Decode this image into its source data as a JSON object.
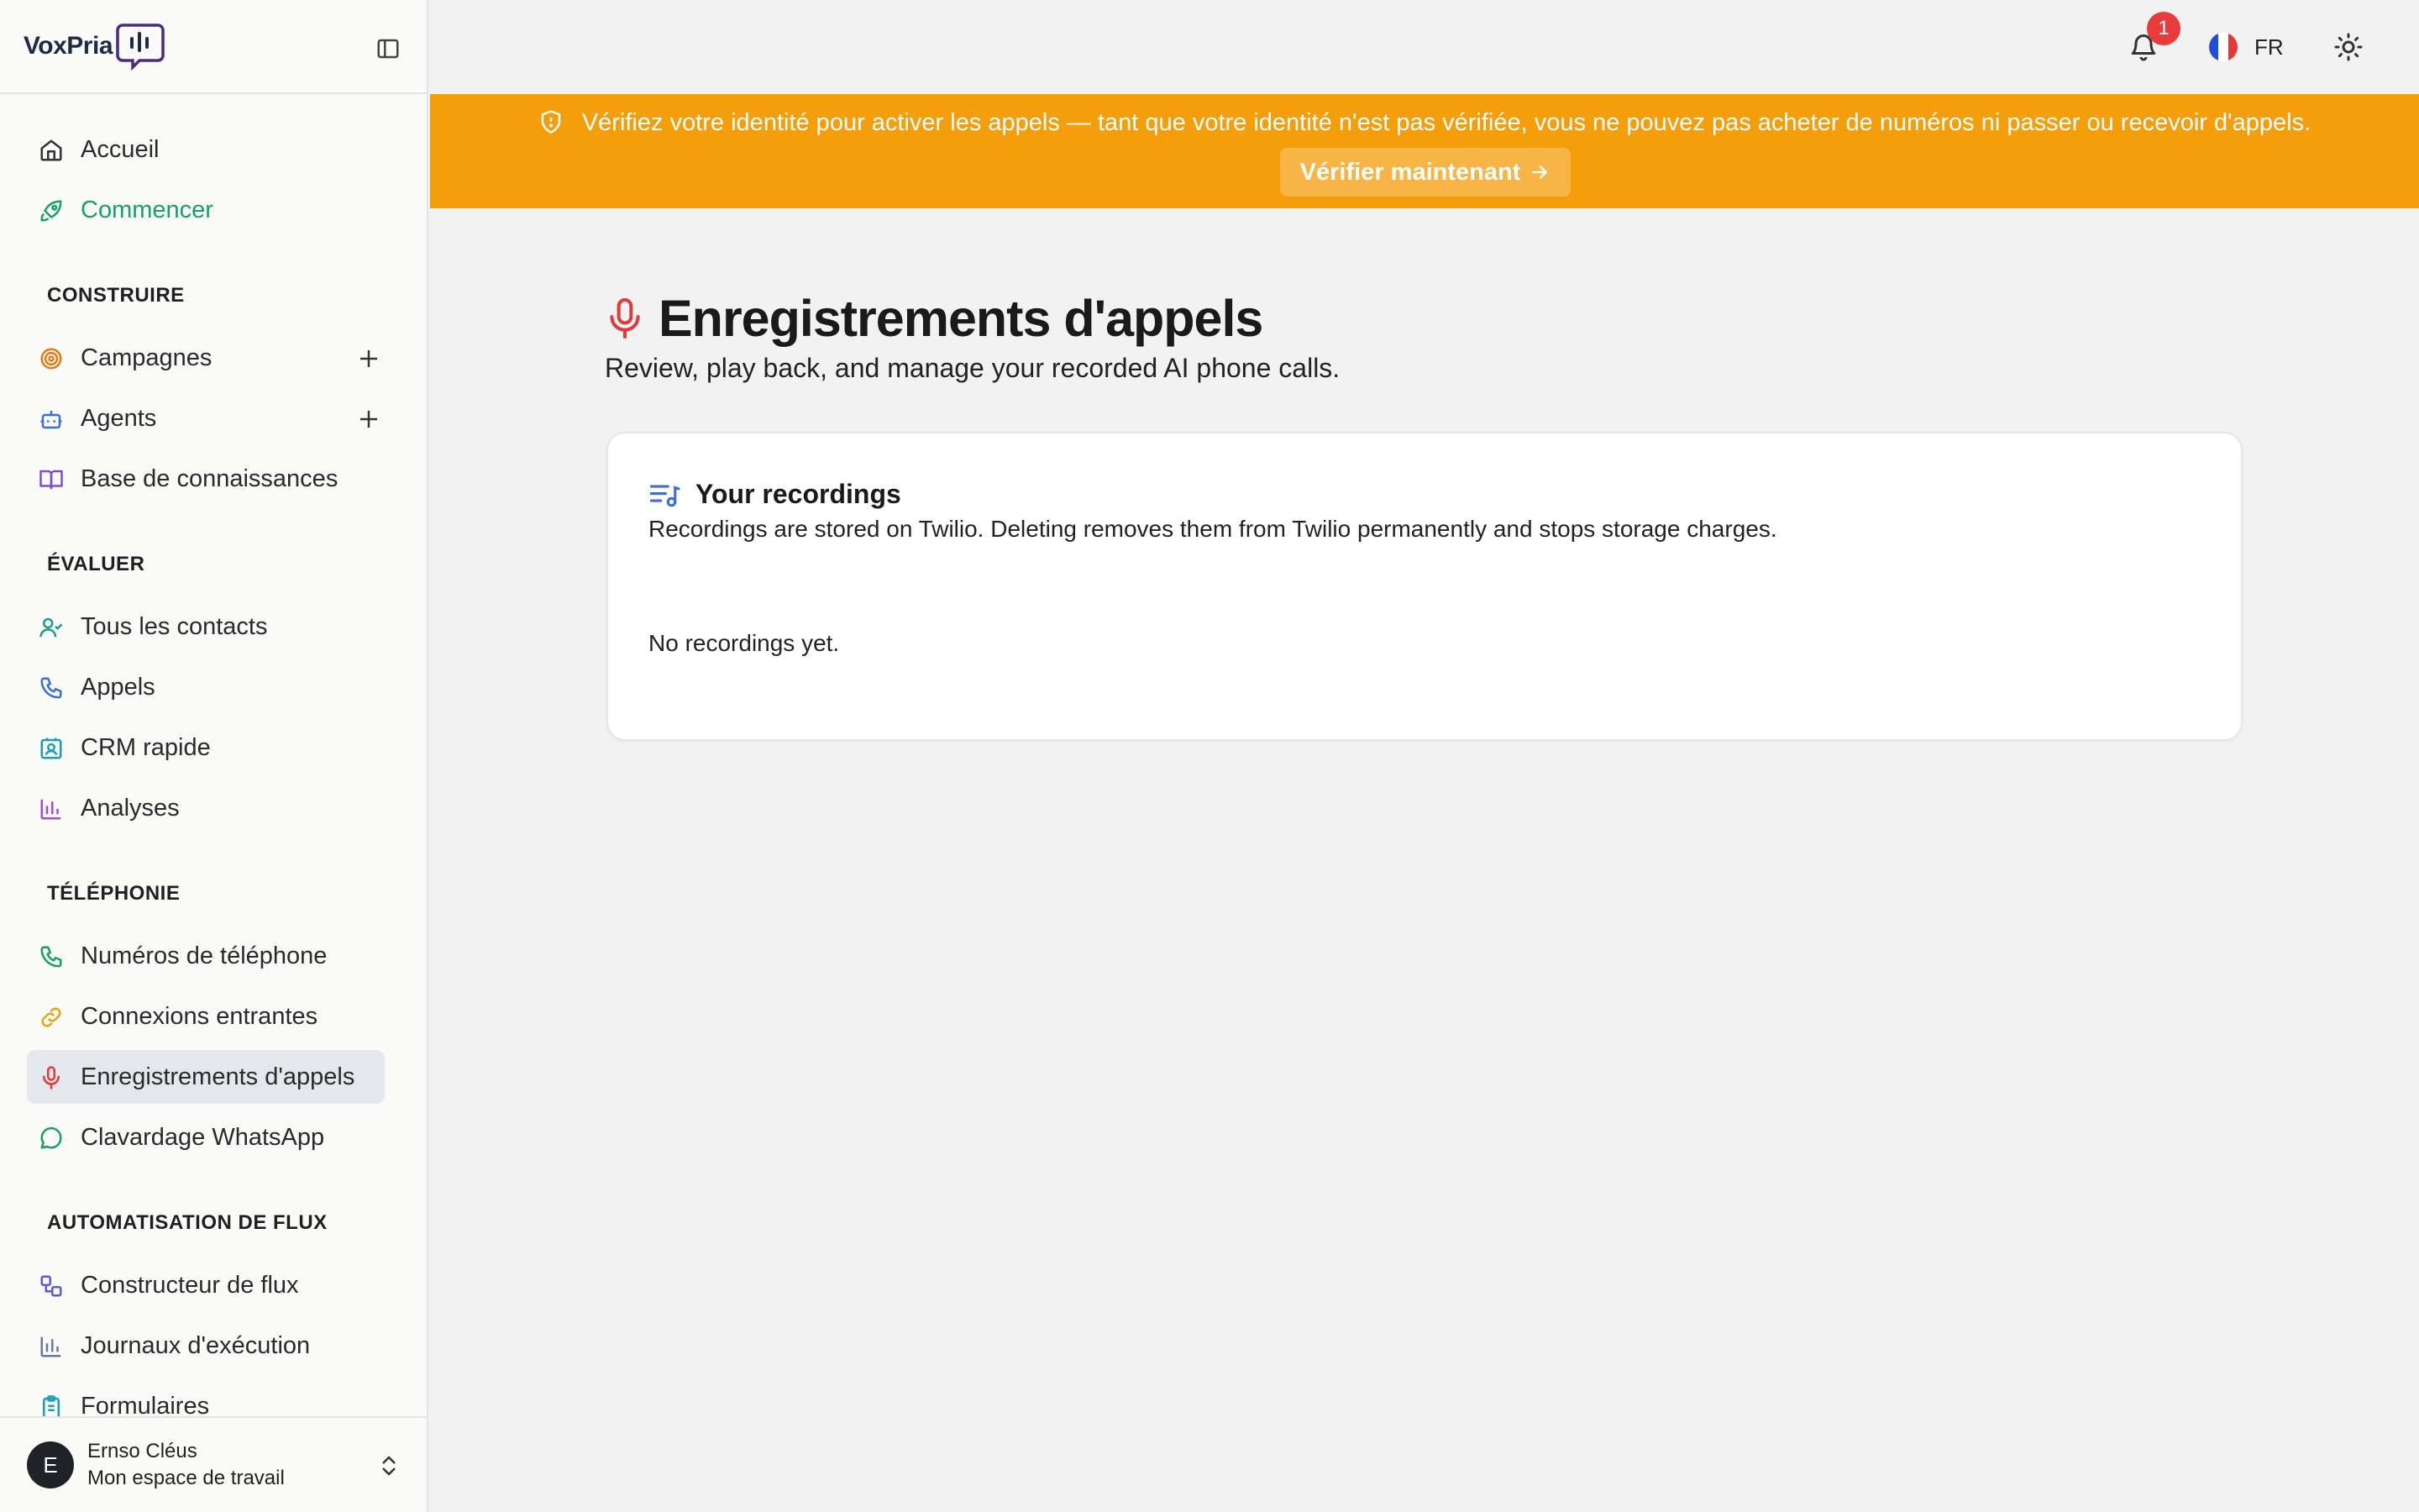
{
  "app": {
    "logo_text": "VoxPria"
  },
  "sidebar": {
    "top_items": [
      {
        "label": "Accueil",
        "icon": "home-icon"
      },
      {
        "label": "Commencer",
        "icon": "rocket-icon"
      }
    ],
    "sections": [
      {
        "title": "CONSTRUIRE",
        "items": [
          {
            "label": "Campagnes",
            "icon": "target-icon"
          },
          {
            "label": "Agents",
            "icon": "bot-icon"
          },
          {
            "label": "Base de connaissances",
            "icon": "book-icon"
          }
        ]
      },
      {
        "title": "ÉVALUER",
        "items": [
          {
            "label": "Tous les contacts",
            "icon": "user-check-icon"
          },
          {
            "label": "Appels",
            "icon": "phone-icon"
          },
          {
            "label": "CRM rapide",
            "icon": "contact-card-icon"
          },
          {
            "label": "Analyses",
            "icon": "bar-chart-icon"
          }
        ]
      },
      {
        "title": "TÉLÉPHONIE",
        "items": [
          {
            "label": "Numéros de téléphone",
            "icon": "phone-icon"
          },
          {
            "label": "Connexions entrantes",
            "icon": "link-icon"
          },
          {
            "label": "Enregistrements d'appels",
            "icon": "mic-icon"
          },
          {
            "label": "Clavardage WhatsApp",
            "icon": "message-circle-icon"
          }
        ]
      },
      {
        "title": "AUTOMATISATION DE FLUX",
        "items": [
          {
            "label": "Constructeur de flux",
            "icon": "workflow-icon"
          },
          {
            "label": "Journaux d'exécution",
            "icon": "bar-chart-icon"
          },
          {
            "label": "Formulaires",
            "icon": "clipboard-icon"
          }
        ]
      }
    ],
    "user": {
      "initial": "E",
      "name": "Ernso Cléus",
      "workspace": "Mon espace de travail"
    }
  },
  "header": {
    "notification_count": "1",
    "language": "FR"
  },
  "banner": {
    "message": "Vérifiez votre identité pour activer les appels — tant que votre identité n'est pas vérifiée, vous ne pouvez pas acheter de numéros ni passer ou recevoir d'appels.",
    "button_label": "Vérifier maintenant"
  },
  "main": {
    "title": "Enregistrements d'appels",
    "subtitle": "Review, play back, and manage your recorded AI phone calls.",
    "card": {
      "title": "Your recordings",
      "description": "Recordings are stored on Twilio. Deleting removes them from Twilio permanently and stops storage charges.",
      "empty_text": "No recordings yet."
    }
  },
  "colors": {
    "accent_green": "#16a06a",
    "banner": "#f59e0b",
    "badge": "#ea3b3b",
    "mic_red": "#e03a3a"
  }
}
